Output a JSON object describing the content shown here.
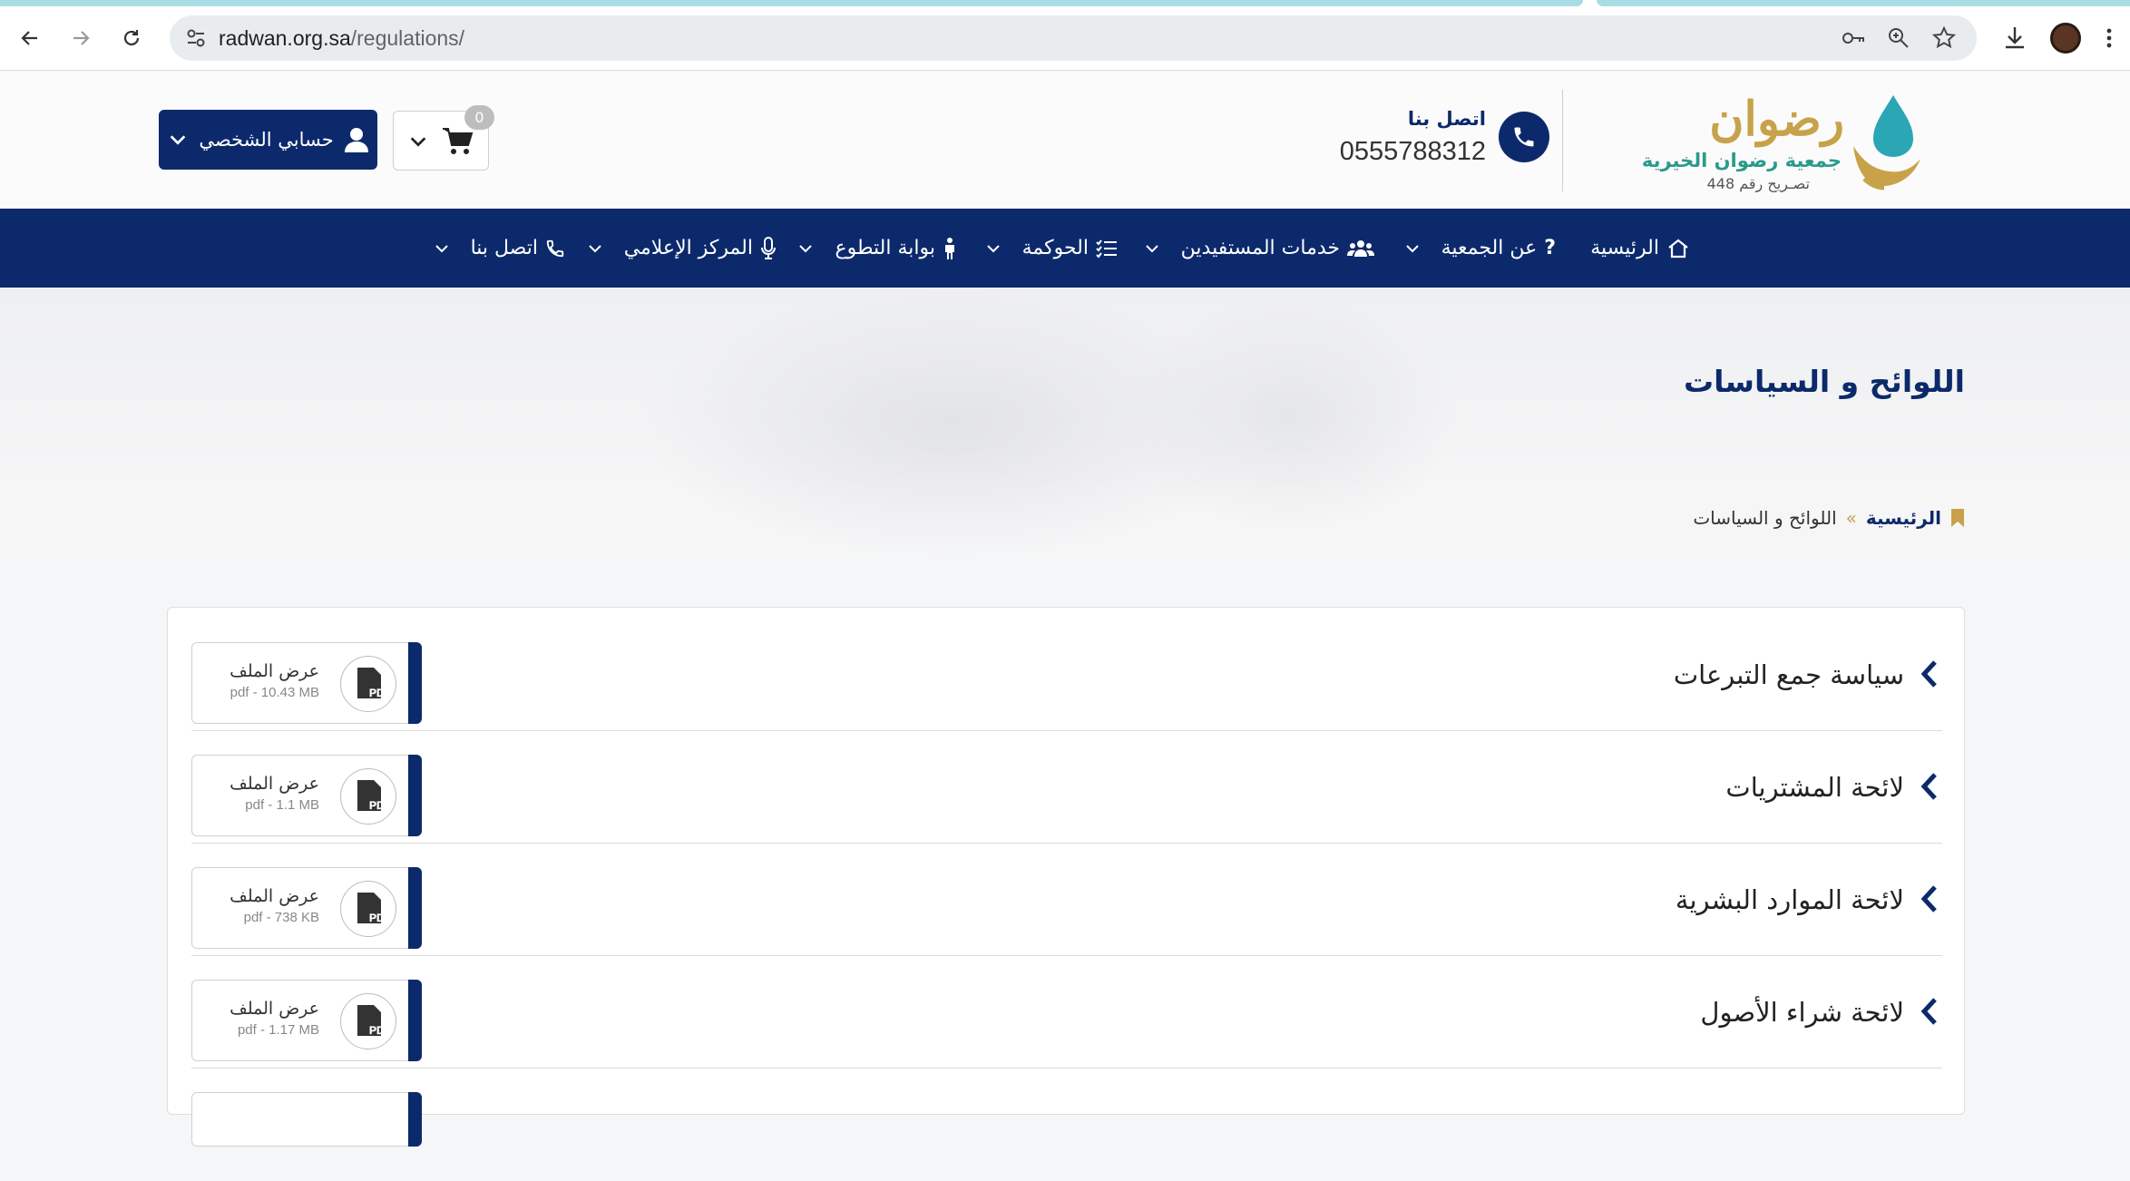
{
  "browser": {
    "url_host": "radwan.org.sa",
    "url_path": "/regulations/"
  },
  "header": {
    "logo_name": "رضوان",
    "logo_subtitle": "جمعية رضوان الخيرية",
    "logo_license": "تصـريح رقم 448",
    "contact_label": "اتصل بنا",
    "contact_number": "0555788312",
    "cart_count": "0",
    "account_label": "حسابي الشخصي"
  },
  "nav": {
    "items": [
      {
        "label": "الرئيسية",
        "icon": "home-icon"
      },
      {
        "label": "عن الجمعية",
        "icon": "question-icon"
      },
      {
        "label": "خدمات المستفيدين",
        "icon": "users-icon"
      },
      {
        "label": "الحوكمة",
        "icon": "list-check-icon"
      },
      {
        "label": "بوابة التطوع",
        "icon": "person-icon"
      },
      {
        "label": "المركز الإعلامي",
        "icon": "microphone-icon"
      },
      {
        "label": "اتصل بنا",
        "icon": "phone-icon"
      }
    ]
  },
  "page": {
    "title": "اللوائح و السياسات",
    "breadcrumb_home": "الرئيسية",
    "breadcrumb_sep": "»",
    "breadcrumb_current": "اللوائح و السياسات"
  },
  "documents": [
    {
      "title": "سياسة جمع التبرعات",
      "view_label": "عرض الملف",
      "meta": "pdf - 10.43 MB"
    },
    {
      "title": "لائحة المشتريات",
      "view_label": "عرض الملف",
      "meta": "pdf - 1.1 MB"
    },
    {
      "title": "لائحة الموارد البشرية",
      "view_label": "عرض الملف",
      "meta": "pdf - 738 KB"
    },
    {
      "title": "لائحة شراء الأصول",
      "view_label": "عرض الملف",
      "meta": "pdf - 1.17 MB"
    }
  ],
  "colors": {
    "primary": "#0c2a6b",
    "gold": "#c8a24a",
    "teal": "#2a9a8a"
  }
}
